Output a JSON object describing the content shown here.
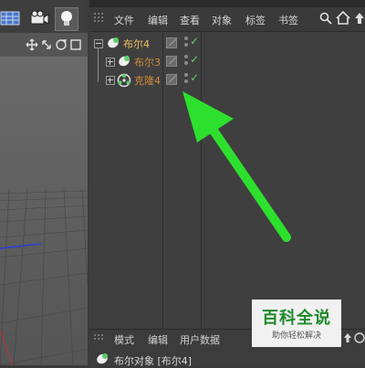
{
  "object_manager": {
    "menu": [
      "文件",
      "编辑",
      "查看",
      "对象",
      "标签",
      "书签"
    ],
    "rows": [
      {
        "label": "布尔4",
        "icon": "boolean-icon",
        "expanded": true
      },
      {
        "label": "布尔3",
        "icon": "boolean-icon",
        "expanded": false
      },
      {
        "label": "克隆4",
        "icon": "cloner-icon",
        "expanded": false
      }
    ]
  },
  "attributes": {
    "menu": [
      "模式",
      "编辑",
      "用户数据"
    ],
    "object_line": "布尔对象 [布尔4]"
  },
  "watermark": {
    "title": "百科全说",
    "subtitle": "助你轻松解决"
  },
  "colors": {
    "arrow": "#2ee02e",
    "check": "#5fd06a",
    "object_label": "#f0c060"
  }
}
